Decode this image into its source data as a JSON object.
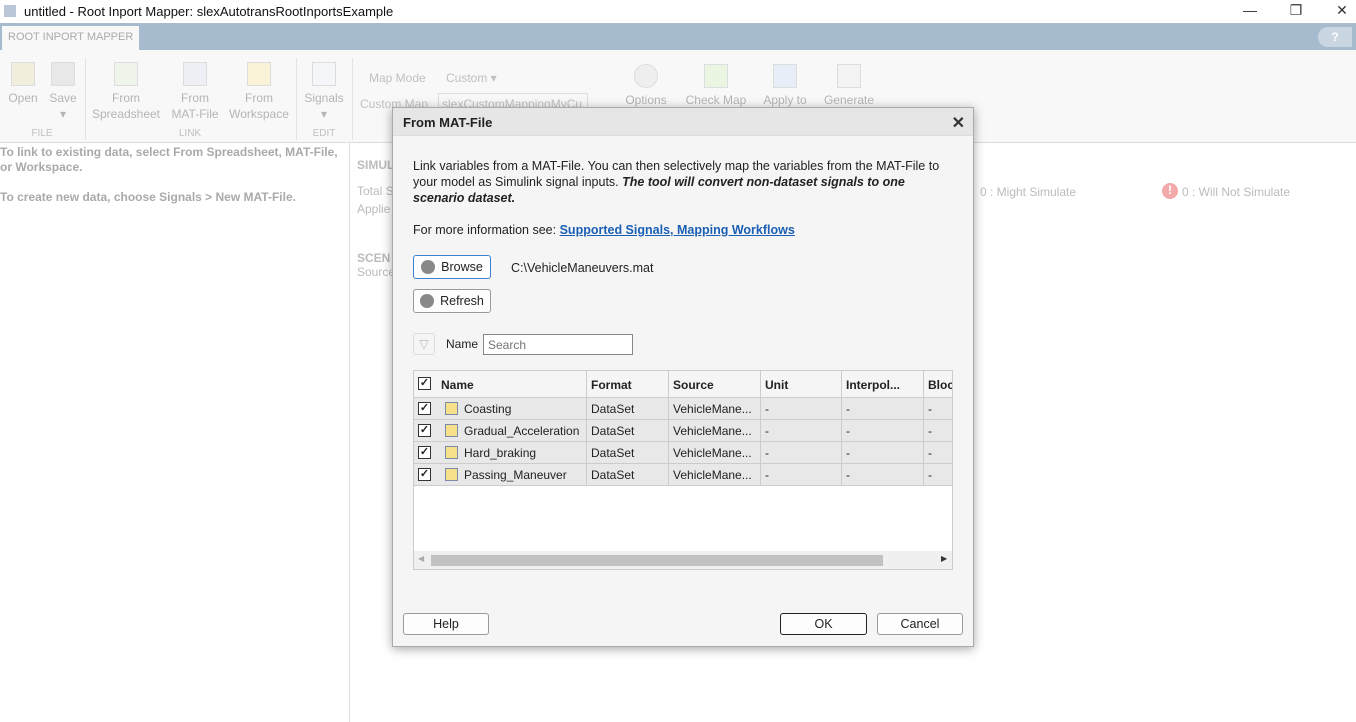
{
  "window": {
    "title": "untitled - Root Inport Mapper: slexAutotransRootInportsExample",
    "minimize": "—",
    "restore": "❐",
    "close": "✕"
  },
  "ribbon": {
    "tab": "ROOT INPORT MAPPER",
    "help": "?",
    "file": {
      "label": "FILE",
      "open": "Open",
      "save": "Save"
    },
    "link": {
      "label": "LINK",
      "from_spreadsheet": [
        "From",
        "Spreadsheet"
      ],
      "from_matfile": [
        "From",
        "MAT-File"
      ],
      "from_workspace": [
        "From",
        "Workspace"
      ]
    },
    "edit": {
      "label": "EDIT",
      "signals": "Signals"
    },
    "map_mode_label": "Map Mode",
    "map_mode_value": "Custom",
    "custom_map_label": "Custom Map",
    "custom_map_value": "slexCustomMappingMyCu",
    "options": "Options",
    "check_map": "Check Map",
    "apply_to": "Apply to",
    "generate": "Generate"
  },
  "left_panel": {
    "line1": "To link to existing data, select From Spreadsheet, MAT-File, or Workspace.",
    "line2": "To create new data, choose Signals > New MAT-File."
  },
  "main": {
    "simulation_header": "SIMUL",
    "total": "Total S",
    "applied": "Applie",
    "might_simulate": "0 : Might Simulate",
    "will_not_simulate": "0 : Will Not Simulate",
    "scenario_header": "SCEN",
    "source": "Source"
  },
  "dialog": {
    "title": "From MAT-File",
    "close": "✕",
    "description": "Link variables from a MAT-File. You can then selectively map the variables from the MAT-File to your model as Simulink signal inputs. ",
    "description_bold": "The tool will convert non-dataset signals to one scenario dataset.",
    "more_info": "For more information see: ",
    "link1": "Supported Signals",
    "link_sep": ", ",
    "link2": "Mapping Workflows",
    "browse": "Browse",
    "file_path": "C:\\VehicleManeuvers.mat",
    "refresh": "Refresh",
    "filter_label": "Name",
    "search_placeholder": "Search",
    "columns": [
      "Name",
      "Format",
      "Source",
      "Unit",
      "Interpol...",
      "Bloc"
    ],
    "rows": [
      {
        "name": "Coasting",
        "format": "DataSet",
        "source": "VehicleMane...",
        "unit": "-",
        "interp": "-",
        "block": "-",
        "checked": true
      },
      {
        "name": "Gradual_Acceleration",
        "format": "DataSet",
        "source": "VehicleMane...",
        "unit": "-",
        "interp": "-",
        "block": "-",
        "checked": true
      },
      {
        "name": "Hard_braking",
        "format": "DataSet",
        "source": "VehicleMane...",
        "unit": "-",
        "interp": "-",
        "block": "-",
        "checked": true
      },
      {
        "name": "Passing_Maneuver",
        "format": "DataSet",
        "source": "VehicleMane...",
        "unit": "-",
        "interp": "-",
        "block": "-",
        "checked": true
      }
    ],
    "help": "Help",
    "ok": "OK",
    "cancel": "Cancel"
  }
}
